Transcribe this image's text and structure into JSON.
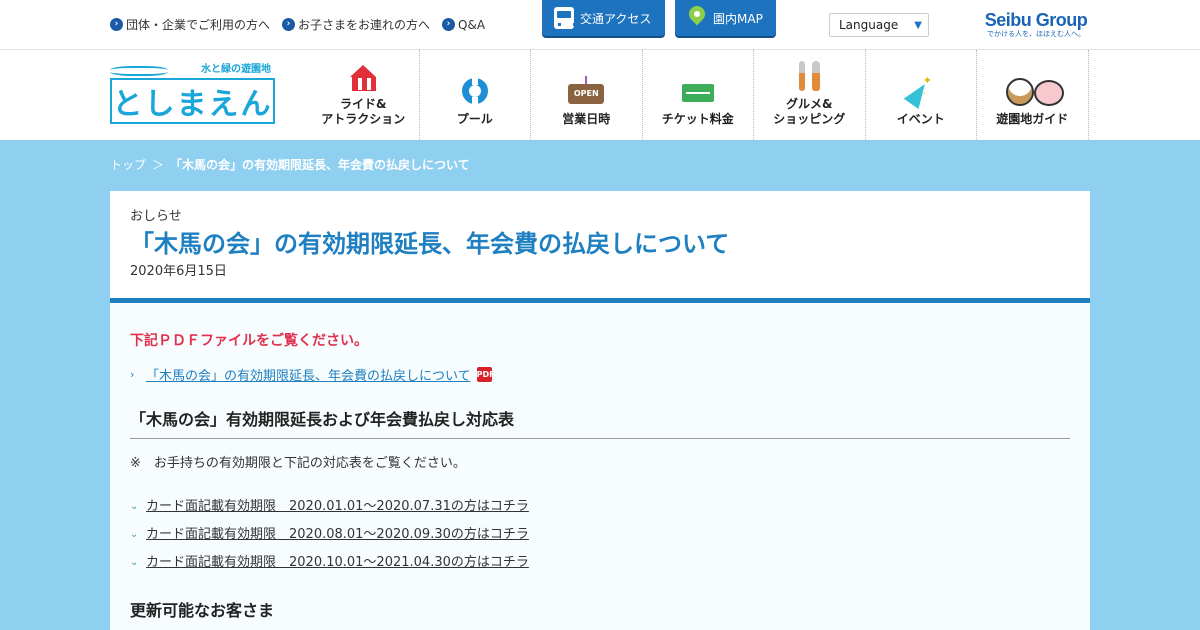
{
  "topbar": {
    "links": [
      {
        "label": "団体・企業でご利用の方へ"
      },
      {
        "label": "お子さまをお連れの方へ"
      },
      {
        "label": "Q&A"
      }
    ],
    "access_label": "交通アクセス",
    "map_label": "園内MAP",
    "language_label": "Language",
    "group_name": "Seibu Group",
    "group_tagline": "でかける人を、ほほえむ人へ。"
  },
  "logo": {
    "sub": "水と緑の遊園地",
    "main": "としまえん"
  },
  "gnav": [
    {
      "label": "ライド&\nアトラクション",
      "icon": "tent-icon"
    },
    {
      "label": "プール",
      "icon": "swim-ring-icon"
    },
    {
      "label": "営業日時",
      "icon": "open-sign-icon"
    },
    {
      "label": "チケット料金",
      "icon": "ticket-icon"
    },
    {
      "label": "グルメ&\nショッピング",
      "icon": "cutlery-icon"
    },
    {
      "label": "イベント",
      "icon": "party-popper-icon"
    },
    {
      "label": "遊園地ガイド",
      "icon": "animals-icon"
    }
  ],
  "breadcrumb": {
    "home": "トップ",
    "sep": "＞",
    "current": "「木馬の会」の有効期限延長、年会費の払戻しについて"
  },
  "article": {
    "eyebrow": "おしらせ",
    "title": "「木馬の会」の有効期限延長、年会費の払戻しについて",
    "date": "2020年6月15日",
    "notice": "下記ＰＤＦファイルをご覧ください。",
    "pdf_link": "「木馬の会」の有効期限延長、年会費の払戻しについて",
    "pdf_badge": "PDF",
    "section_title": "「木馬の会」有効期限延長および年会費払戻し対応表",
    "section_note": "※　お手持ちの有効期限と下記の対応表をご覧ください。",
    "period_links": [
      "カード面記載有効期限　2020.01.01～2020.07.31の方はコチラ",
      "カード面記載有効期限　2020.08.01～2020.09.30の方はコチラ",
      "カード面記載有効期限　2020.10.01～2021.04.30の方はコチラ"
    ],
    "subsection_title": "更新可能なお客さま"
  },
  "colors": {
    "accent": "#1e7fc1",
    "notice": "#e0304e",
    "background": "#8fcff0"
  }
}
